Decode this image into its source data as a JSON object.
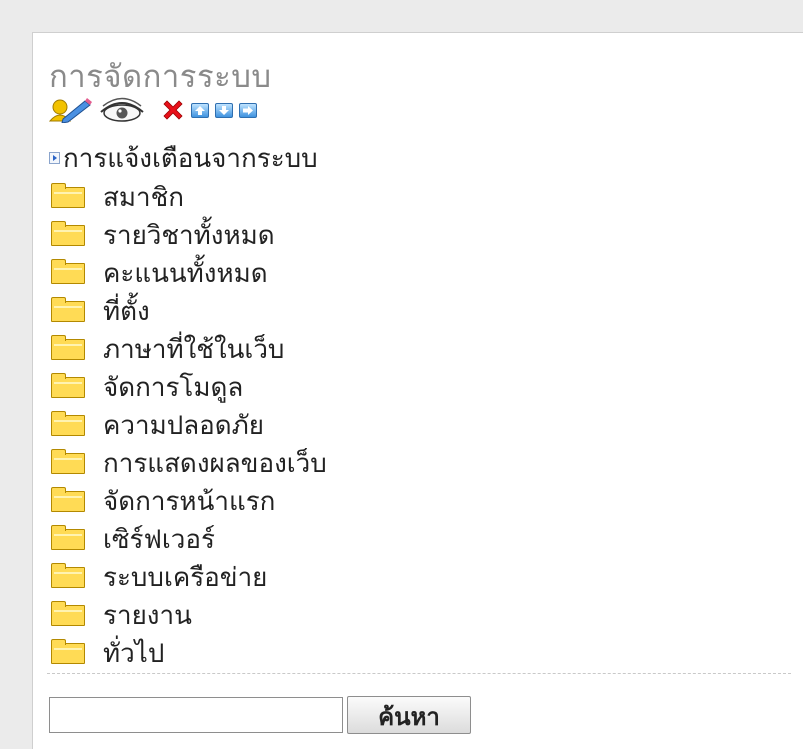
{
  "panel": {
    "title": "การจัดการระบบ",
    "toolbar": {
      "icons": [
        "edit-icon",
        "view-icon",
        "delete-icon",
        "move-up-icon",
        "move-down-icon",
        "move-right-icon"
      ]
    },
    "notification_link": "การแจ้งเตือนจากระบบ",
    "folders": [
      "สมาชิก",
      "รายวิชาทั้งหมด",
      "คะแนนทั้งหมด",
      "ที่ตั้ง",
      "ภาษาที่ใช้ในเว็บ",
      "จัดการโมดูล",
      "ความปลอดภัย",
      "การแสดงผลของเว็บ",
      "จัดการหน้าแรก",
      "เซิร์ฟเวอร์",
      "ระบบเครือข่าย",
      "รายงาน",
      "ทั่วไป"
    ],
    "search": {
      "value": "",
      "button_label": "ค้นหา"
    }
  },
  "colors": {
    "background": "#ebebeb",
    "panel": "#ffffff",
    "title_text": "#8a8a8a",
    "folder": "#ffdb55",
    "arrow_button": "#3f93df",
    "delete_icon": "#e8101a"
  }
}
